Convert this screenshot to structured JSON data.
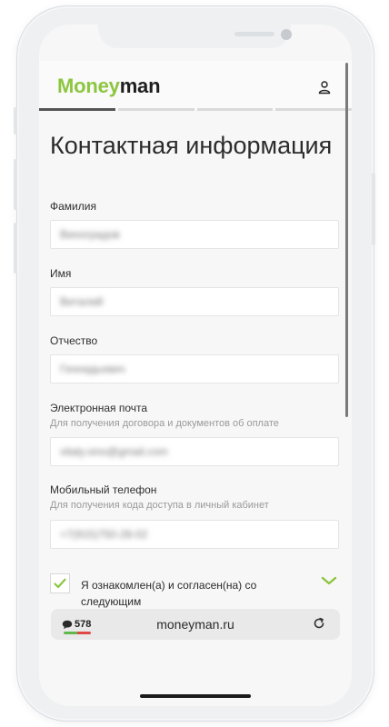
{
  "brand": {
    "logo_part1": "Money",
    "logo_part2": "man"
  },
  "header": {
    "user_icon": "user-icon"
  },
  "progress": {
    "steps_total": 4,
    "current_step": 1
  },
  "page": {
    "title": "Контактная информация"
  },
  "form": {
    "fields": [
      {
        "label": "Фамилия",
        "hint": "",
        "value": "Виноградов"
      },
      {
        "label": "Имя",
        "hint": "",
        "value": "Виталий"
      },
      {
        "label": "Отчество",
        "hint": "",
        "value": "Геннадьевич"
      },
      {
        "label": "Электронная почта",
        "hint": "Для получения договора и документов об оплате",
        "value": "vitaly.vino@gmail.com"
      },
      {
        "label": "Мобильный телефон",
        "hint": "Для получения кода доступа в личный кабинет",
        "value": "+7(915)750-28-02"
      }
    ]
  },
  "consent": {
    "text": "Я ознакомлен(а) и согласен(на) со следующим",
    "checked": true,
    "expand_icon": "chevron-down-icon"
  },
  "browser": {
    "badge_count": "578",
    "url": "moneyman.ru",
    "reload_icon": "reload-icon"
  },
  "colors": {
    "accent": "#8cc63f",
    "text": "#2c2c2c"
  }
}
